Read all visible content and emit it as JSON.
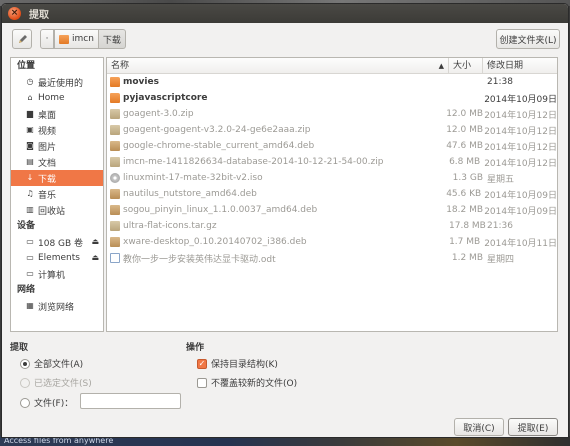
{
  "window": {
    "title": "提取"
  },
  "toolbar": {
    "path": [
      "imcn",
      "下载"
    ],
    "create_folder": "创建文件夹(L)"
  },
  "sidebar": {
    "sections": [
      {
        "title": "位置",
        "items": [
          {
            "label": "最近使用的",
            "icon": "clock-icon"
          },
          {
            "label": "Home",
            "icon": "home-icon"
          },
          {
            "label": "桌面",
            "icon": "desktop-icon"
          },
          {
            "label": "视频",
            "icon": "video-icon"
          },
          {
            "label": "图片",
            "icon": "camera-icon"
          },
          {
            "label": "文档",
            "icon": "document-icon"
          },
          {
            "label": "下载",
            "icon": "download-icon",
            "selected": true
          },
          {
            "label": "音乐",
            "icon": "music-icon"
          },
          {
            "label": "回收站",
            "icon": "trash-icon"
          }
        ]
      },
      {
        "title": "设备",
        "items": [
          {
            "label": "108 GB 卷",
            "icon": "drive-icon",
            "eject": true
          },
          {
            "label": "Elements",
            "icon": "drive-icon",
            "eject": true
          },
          {
            "label": "计算机",
            "icon": "computer-icon"
          }
        ]
      },
      {
        "title": "网络",
        "items": [
          {
            "label": "浏览网络",
            "icon": "network-icon"
          }
        ]
      }
    ]
  },
  "filelist": {
    "columns": {
      "name": "名称",
      "size": "大小",
      "modified": "修改日期"
    },
    "rows": [
      {
        "name": "movies",
        "size": "",
        "modified": "21:38",
        "type": "folder"
      },
      {
        "name": "pyjavascriptcore",
        "size": "",
        "modified": "2014年10月09日",
        "type": "folder"
      },
      {
        "name": "goagent-3.0.zip",
        "size": "12.0 MB",
        "modified": "2014年10月12日",
        "type": "archive"
      },
      {
        "name": "goagent-goagent-v3.2.0-24-ge6e2aaa.zip",
        "size": "12.0 MB",
        "modified": "2014年10月12日",
        "type": "archive"
      },
      {
        "name": "google-chrome-stable_current_amd64.deb",
        "size": "47.6 MB",
        "modified": "2014年10月12日",
        "type": "package"
      },
      {
        "name": "imcn-me-1411826634-database-2014-10-12-21-54-00.zip",
        "size": "6.8 MB",
        "modified": "2014年10月12日",
        "type": "archive"
      },
      {
        "name": "linuxmint-17-mate-32bit-v2.iso",
        "size": "1.3 GB",
        "modified": "星期五",
        "type": "disc"
      },
      {
        "name": "nautilus_nutstore_amd64.deb",
        "size": "45.6 KB",
        "modified": "2014年10月09日",
        "type": "package"
      },
      {
        "name": "sogou_pinyin_linux_1.1.0.0037_amd64.deb",
        "size": "18.2 MB",
        "modified": "2014年10月09日",
        "type": "package"
      },
      {
        "name": "ultra-flat-icons.tar.gz",
        "size": "17.8 MB",
        "modified": "21:36",
        "type": "archive"
      },
      {
        "name": "xware-desktop_0.10.20140702_i386.deb",
        "size": "1.7 MB",
        "modified": "2014年10月11日",
        "type": "package"
      },
      {
        "name": "教你一步一步安装英伟达显卡驱动.odt",
        "size": "1.2 MB",
        "modified": "星期四",
        "type": "doc"
      }
    ]
  },
  "extract": {
    "title": "提取",
    "all_files": "全部文件(A)",
    "selected_files": "已选定文件(S)",
    "files": "文件(F)："
  },
  "actions": {
    "title": "操作",
    "keep_structure": "保持目录结构(K)",
    "no_overwrite": "不覆盖较新的文件(O)"
  },
  "buttons": {
    "cancel": "取消(C)",
    "extract": "提取(E)"
  },
  "background": {
    "bottom_text": "Access files from anywhere"
  },
  "colors": {
    "accent": "#f07746",
    "titlebar": "#3c3b37"
  }
}
